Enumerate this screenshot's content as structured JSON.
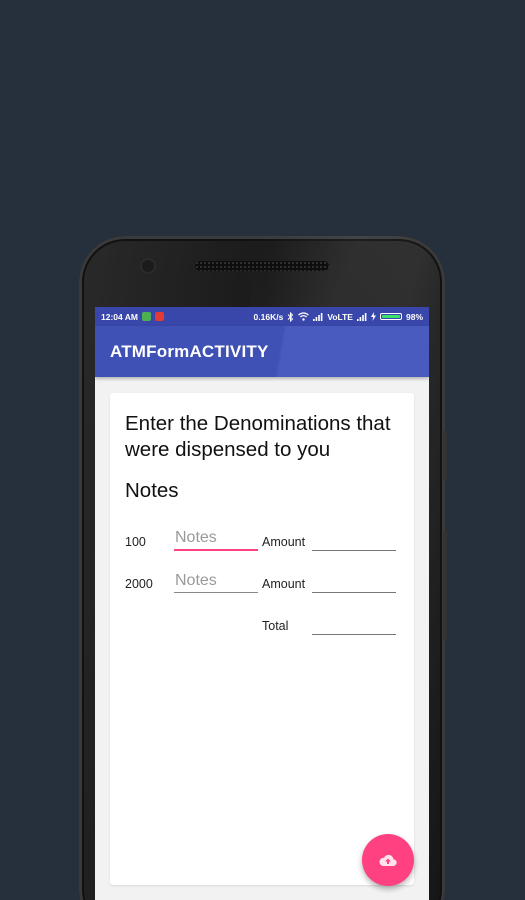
{
  "status_bar": {
    "time": "12:04 AM",
    "network_speed": "0.16K/s",
    "network_type": "VoLTE",
    "battery": "98%",
    "battery_level": 0.98,
    "notification_icons": [
      "battery-app-icon",
      "youtube-icon"
    ],
    "system_icons": [
      "bluetooth-icon",
      "wifi-icon",
      "signal-icon",
      "signal-icon",
      "charging-icon"
    ],
    "colors": {
      "background": "#3847a9",
      "battery_fill": "#3ce36b"
    }
  },
  "app_bar": {
    "title": "ATMFormACTIVITY",
    "color": "#3f51b5"
  },
  "form": {
    "heading": "Enter the Denominations that were dispensed to you",
    "section_title": "Notes",
    "rows": [
      {
        "denomination": "100",
        "notes_value": "",
        "notes_placeholder": "Notes",
        "amount_label": "Amount",
        "focused": true
      },
      {
        "denomination": "2000",
        "notes_value": "",
        "notes_placeholder": "Notes",
        "amount_label": "Amount",
        "focused": false
      }
    ],
    "total_label": "Total"
  },
  "fab": {
    "icon": "cloud-upload-icon",
    "color": "#ff4081"
  },
  "colors": {
    "page_background": "#26303d",
    "accent": "#ff4081"
  }
}
